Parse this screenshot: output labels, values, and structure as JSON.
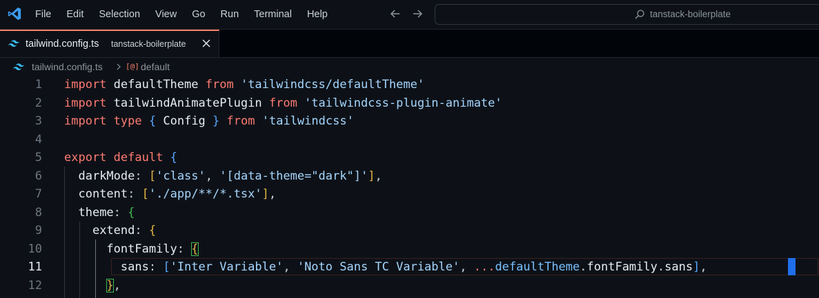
{
  "menu": [
    "File",
    "Edit",
    "Selection",
    "View",
    "Go",
    "Run",
    "Terminal",
    "Help"
  ],
  "search": {
    "text": "tanstack-boilerplate"
  },
  "tab": {
    "filename": "tailwind.config.ts",
    "description": "tanstack-boilerplate"
  },
  "breadcrumb": {
    "file": "tailwind.config.ts",
    "symbol_icon": "[@]",
    "symbol": "default"
  },
  "editor": {
    "active_line": 11,
    "line_numbers": [
      "1",
      "2",
      "3",
      "4",
      "5",
      "6",
      "7",
      "8",
      "9",
      "10",
      "11",
      "12"
    ],
    "lines": [
      "import defaultTheme from 'tailwindcss/defaultTheme'",
      "import tailwindAnimatePlugin from 'tailwindcss-plugin-animate'",
      "import type { Config } from 'tailwindcss'",
      "",
      "export default {",
      "  darkMode: ['class', '[data-theme=\"dark\"]'],",
      "  content: ['./app/**/*.tsx'],",
      "  theme: {",
      "    extend: {",
      "      fontFamily: {",
      "        sans: ['Inter Variable', 'Noto Sans TC Variable', ...defaultTheme.fontFamily.sans],",
      "      },"
    ]
  },
  "colors": {
    "keyword": "#ff7b72",
    "string": "#a5d6ff",
    "bracket_level1": "#58a6ff",
    "bracket_level2": "#e3b341",
    "bracket_level3": "#3fb950",
    "cursor": "#1f6feb"
  }
}
